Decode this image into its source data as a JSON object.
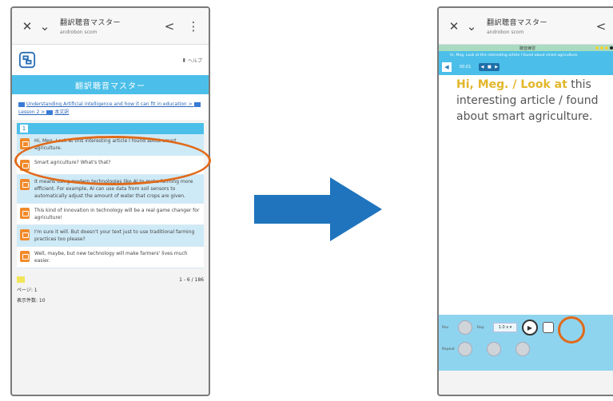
{
  "app": {
    "title": "翻訳聴音マスター",
    "subtitle": "androbon scom",
    "banner": "翻訳聴音マスター",
    "help_label": "ヘルプ"
  },
  "left": {
    "breadcrumbs": [
      "Understanding Artificial intelligence and how it can fit in education",
      "Lesson 2",
      "本文訳"
    ],
    "section_number": "1",
    "rows": [
      {
        "text": "Hi, Meg. Look at this interesting article I found about smart agriculture."
      },
      {
        "text": "Smart agriculture? What's that?"
      },
      {
        "text": "It means using modern technologies like AI to make farming more efficient. For example, AI can use data from soil sensors to automatically adjust the amount of water that crops are given."
      },
      {
        "text": "This kind of innovation in technology will be a real game changer for agriculture!"
      },
      {
        "text": "I'm sure it will. But doesn't your text just to use traditional farming practices too please?"
      },
      {
        "text": "Well, maybe, but new technology will make farmers' lives much easier."
      }
    ],
    "pager_range": "1 - 6 / 186",
    "page_label": "ページ: 1",
    "count_label": "表示件数: 10"
  },
  "right": {
    "stripe_label": "聴音練習",
    "sentence_bar": "Hi, Meg. Look at this interesting article I found about smart agriculture.",
    "time": "00:01",
    "reading_pre": "Hi, Meg. / Look at",
    "reading_post": "this interesting article / found about smart agriculture.",
    "controls": {
      "left_label": "Rev",
      "speed_label": "Rep",
      "speed_value": "1.0 x ▾",
      "bottom_label": "Repeat"
    }
  },
  "colors": {
    "accent": "#4bbfe9",
    "highlight_orange": "#e06a1a",
    "arrow_blue": "#1f74bd",
    "reading_highlight": "#e2b62a"
  }
}
